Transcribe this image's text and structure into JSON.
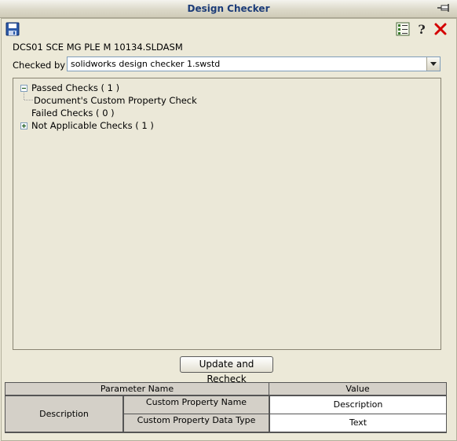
{
  "window": {
    "title": "Design Checker"
  },
  "toolbar": {
    "save_icon": "save-icon",
    "list_icon": "checklist-icon",
    "help_icon": "help-icon",
    "close_icon": "close-icon"
  },
  "document": {
    "name": "DCS01 SCE MG PLE M 10134.SLDASM"
  },
  "checked_by": {
    "label": "Checked by :",
    "value": "solidworks design checker 1.swstd"
  },
  "tree": [
    {
      "label": "Passed Checks ( 1 )",
      "expanded": true
    },
    {
      "label": "Document's Custom Property Check",
      "child": true
    },
    {
      "label": "Failed Checks ( 0 )"
    },
    {
      "label": "Not Applicable Checks ( 1 )",
      "expanded": false
    }
  ],
  "recheck_button": {
    "label": "Update and Recheck"
  },
  "parameters": {
    "headers": {
      "name": "Parameter Name",
      "value": "Value"
    },
    "group": "Description",
    "rows": [
      {
        "name": "Custom Property Name",
        "value": "Description"
      },
      {
        "name": "Custom Property Data Type",
        "value": "Text"
      }
    ]
  },
  "colors": {
    "close": "#d40000",
    "title_text": "#1c3c78",
    "panel": "#ece9d8"
  }
}
